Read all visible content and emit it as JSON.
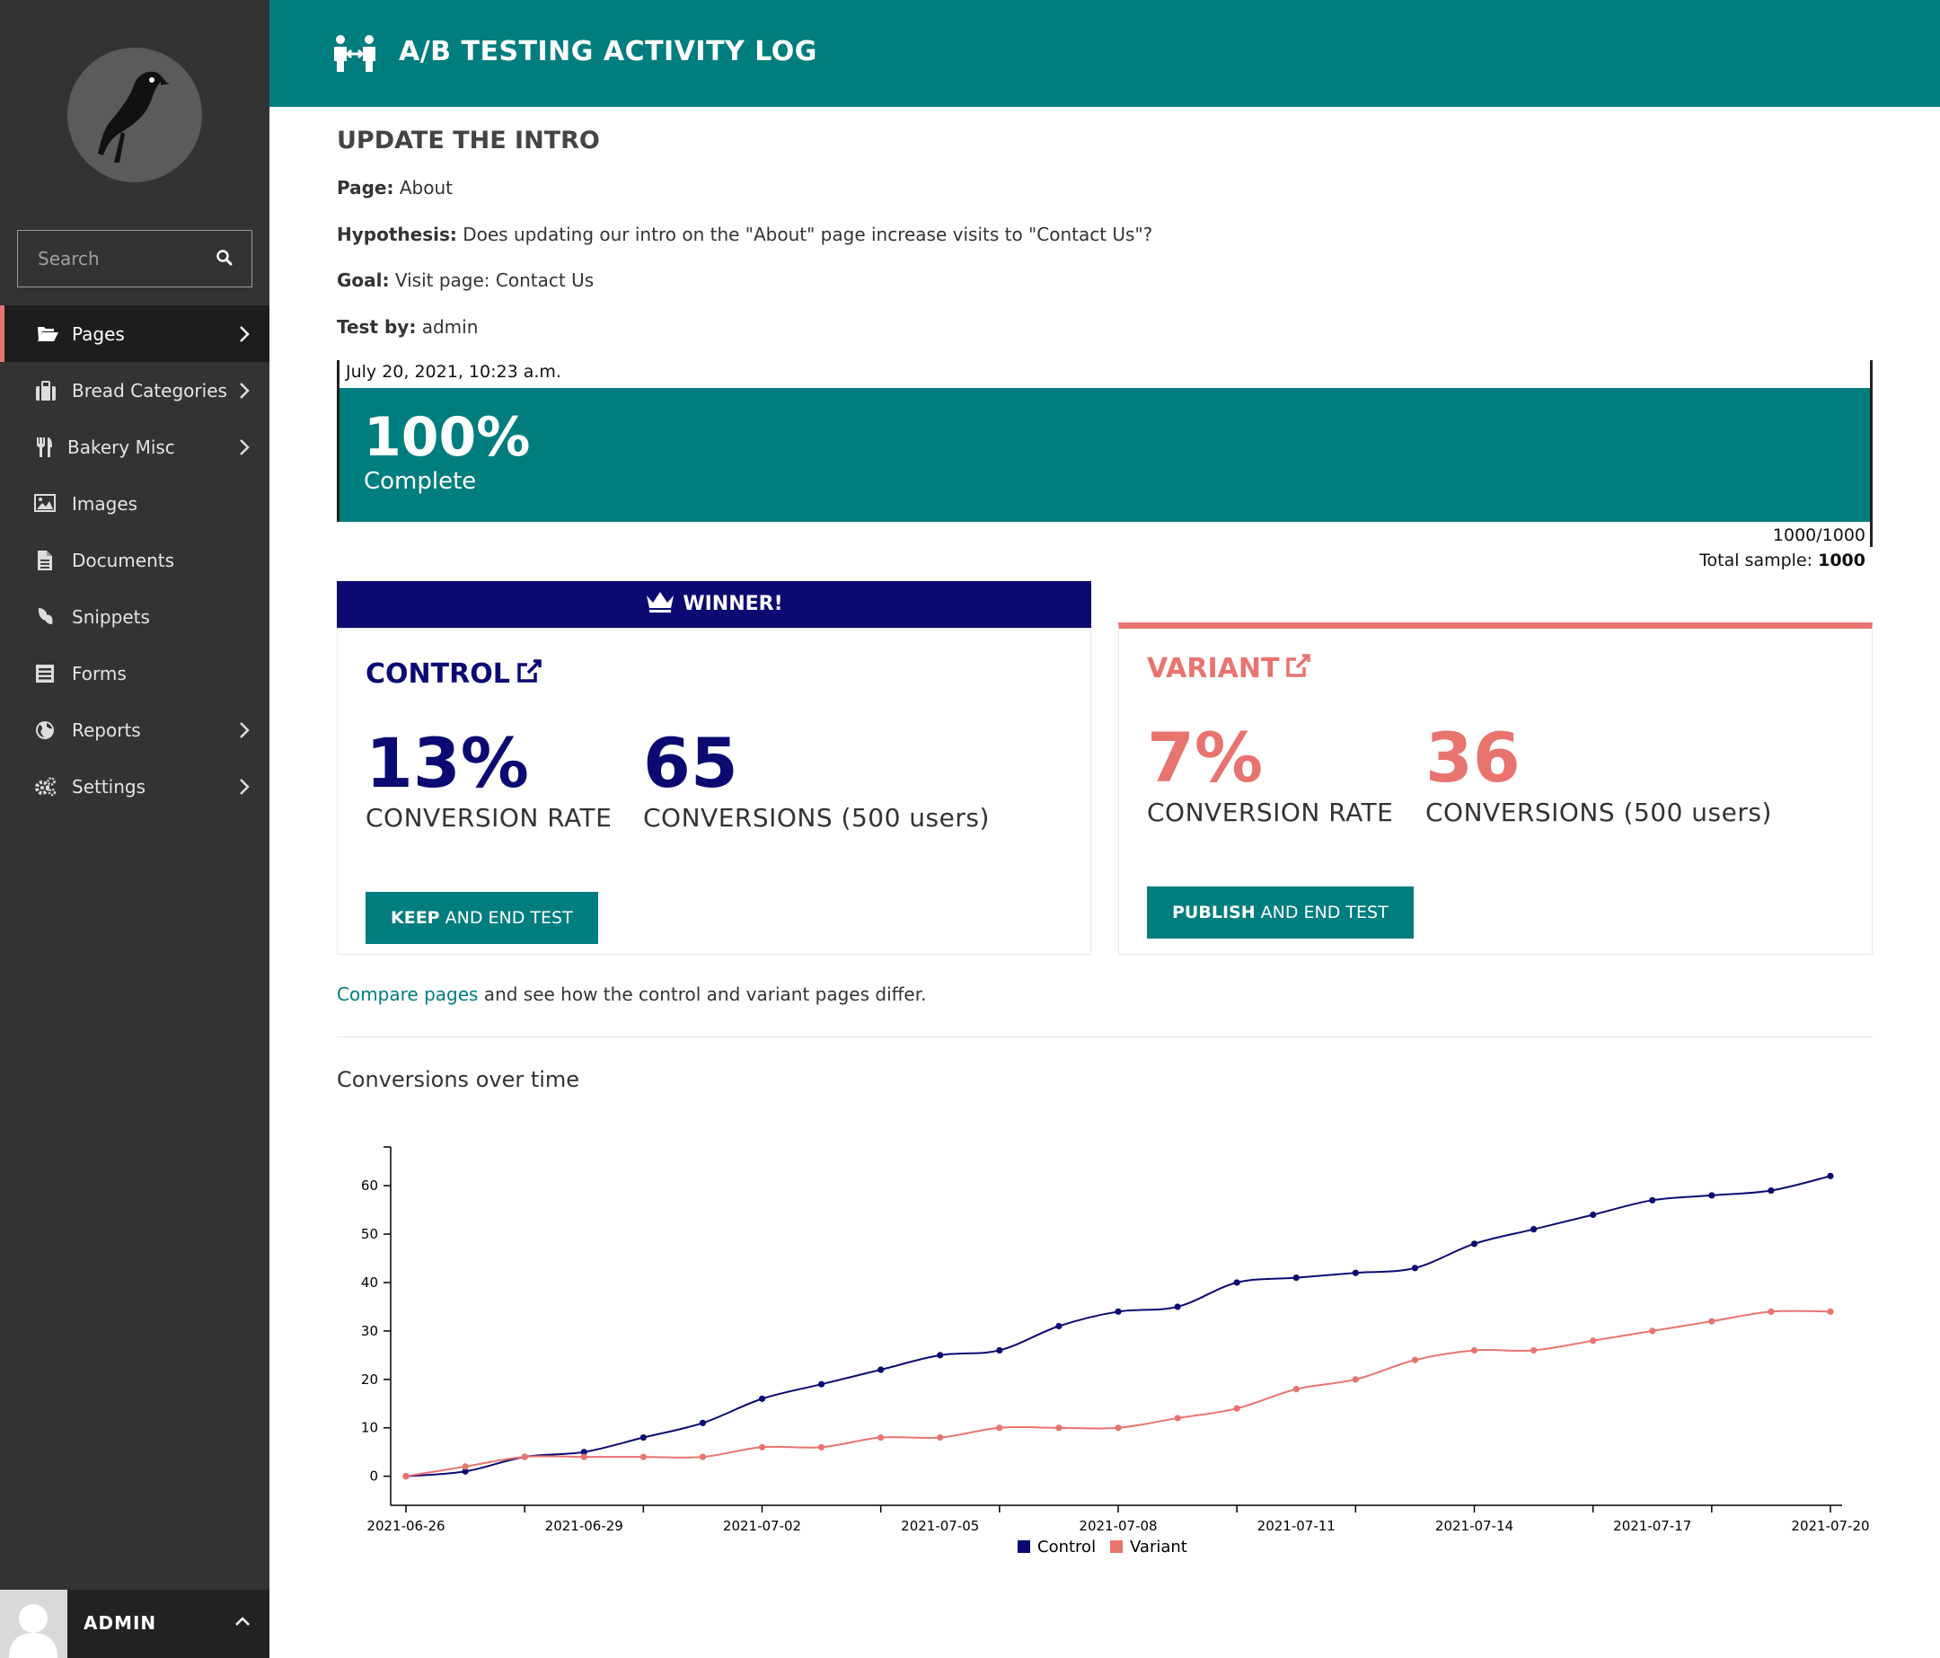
{
  "sidebar": {
    "search": {
      "placeholder": "Search"
    },
    "items": [
      {
        "label": "Pages",
        "icon": "folder-open-icon",
        "active": true,
        "has_children": true
      },
      {
        "label": "Bread Categories",
        "icon": "suitcase-icon",
        "active": false,
        "has_children": true
      },
      {
        "label": "Bakery Misc",
        "icon": "utensils-icon",
        "active": false,
        "has_children": true
      },
      {
        "label": "Images",
        "icon": "image-icon",
        "active": false,
        "has_children": false
      },
      {
        "label": "Documents",
        "icon": "document-icon",
        "active": false,
        "has_children": false
      },
      {
        "label": "Snippets",
        "icon": "snippet-icon",
        "active": false,
        "has_children": false
      },
      {
        "label": "Forms",
        "icon": "form-icon",
        "active": false,
        "has_children": false
      },
      {
        "label": "Reports",
        "icon": "globe-icon",
        "active": false,
        "has_children": true
      },
      {
        "label": "Settings",
        "icon": "cogs-icon",
        "active": false,
        "has_children": true
      }
    ],
    "account": {
      "name": "ADMIN"
    }
  },
  "header": {
    "title": "A/B TESTING ACTIVITY LOG",
    "icon": "ab-test-icon"
  },
  "test": {
    "name": "Update the intro",
    "page_label": "Page:",
    "page_value": "About",
    "hypothesis_label": "Hypothesis:",
    "hypothesis_value": "Does updating our intro on the \"About\" page increase visits to \"Contact Us\"?",
    "goal_label": "Goal:",
    "goal_value": "Visit page: Contact Us",
    "testby_label": "Test by:",
    "testby_value": "admin"
  },
  "progress": {
    "date": "July 20, 2021, 10:23 a.m.",
    "percent": "100%",
    "percent_value": 100,
    "complete_label": "Complete",
    "count": "1000/1000",
    "total_label": "Total sample:",
    "total_value": "1000"
  },
  "winner_banner": "WINNER!",
  "control": {
    "title": "Control",
    "rate": "13%",
    "rate_label": "Conversion rate",
    "conversions": "65",
    "conversions_label": "Conversions",
    "conversions_users": "(500 users)",
    "button_bold": "KEEP",
    "button_rest": " AND END TEST"
  },
  "variant": {
    "title": "Variant",
    "rate": "7%",
    "rate_label": "Conversion rate",
    "conversions": "36",
    "conversions_label": "Conversions",
    "conversions_users": "(500 users)",
    "button_bold": "PUBLISH",
    "button_rest": " AND END TEST"
  },
  "compare": {
    "link": "Compare pages",
    "rest": " and see how the control and variant pages differ."
  },
  "chart_title": "Conversions over time",
  "colors": {
    "teal": "#007d7e",
    "control": "#0a0a72",
    "variant": "#e9736f",
    "sidebar": "#333333"
  },
  "chart_data": {
    "type": "line",
    "x": [
      "2021-06-26",
      "2021-06-27",
      "2021-06-28",
      "2021-06-29",
      "2021-06-30",
      "2021-07-01",
      "2021-07-02",
      "2021-07-03",
      "2021-07-04",
      "2021-07-05",
      "2021-07-06",
      "2021-07-07",
      "2021-07-08",
      "2021-07-09",
      "2021-07-10",
      "2021-07-11",
      "2021-07-12",
      "2021-07-13",
      "2021-07-14",
      "2021-07-15",
      "2021-07-16",
      "2021-07-17",
      "2021-07-18",
      "2021-07-19",
      "2021-07-20"
    ],
    "x_tick_labels": [
      "2021-06-26",
      "2021-06-29",
      "2021-07-02",
      "2021-07-05",
      "2021-07-08",
      "2021-07-11",
      "2021-07-14",
      "2021-07-17",
      "2021-07-20"
    ],
    "series": [
      {
        "name": "Control",
        "color": "#0a0a72",
        "values": [
          0,
          1,
          4,
          5,
          8,
          11,
          16,
          19,
          22,
          25,
          26,
          31,
          34,
          35,
          40,
          41,
          42,
          43,
          48,
          51,
          54,
          57,
          58,
          59,
          62
        ]
      },
      {
        "name": "Variant",
        "color": "#e9736f",
        "values": [
          0,
          2,
          4,
          4,
          4,
          4,
          6,
          6,
          8,
          8,
          10,
          10,
          10,
          12,
          14,
          18,
          20,
          24,
          26,
          26,
          28,
          30,
          32,
          34,
          34
        ]
      }
    ],
    "yticks": [
      0,
      10,
      20,
      30,
      40,
      50,
      60
    ],
    "ylim": [
      -6,
      68
    ],
    "title": "Conversions over time",
    "legend": "bottom-center"
  }
}
